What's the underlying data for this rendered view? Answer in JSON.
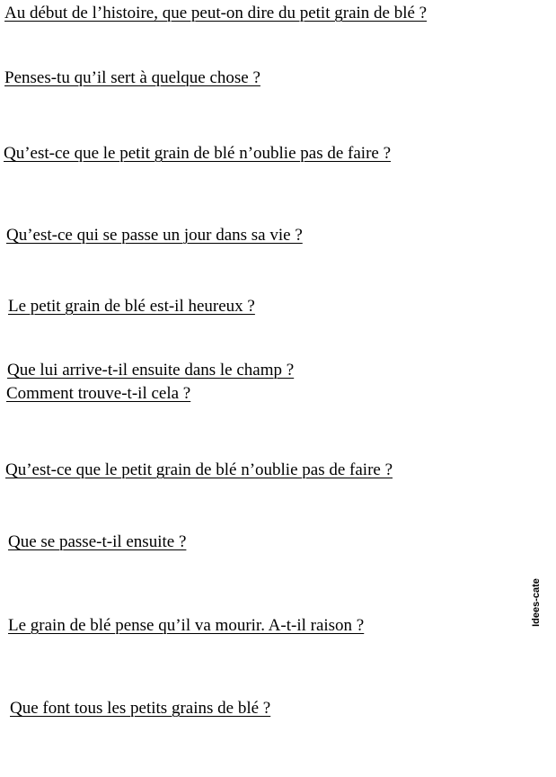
{
  "questions": [
    "Au début de l’histoire, que peut-on dire  du petit grain de blé ?",
    "Penses-tu qu’il sert à quelque chose ?",
    "Qu’est-ce que le petit grain de blé n’oublie pas de faire ?",
    "Qu’est-ce qui se passe un jour dans sa vie ?",
    "Le petit grain de blé est-il heureux ?",
    "Que lui arrive-t-il ensuite dans le champ ?",
    "Comment trouve-t-il cela ?",
    "Qu’est-ce que le petit grain de blé n’oublie pas de faire ?",
    "Que se passe-t-il ensuite ?",
    "Le grain de blé pense qu’il va mourir. A-t-il raison ?",
    "Que font tous les petits grains de blé ?"
  ],
  "watermark": "Idees-cate"
}
